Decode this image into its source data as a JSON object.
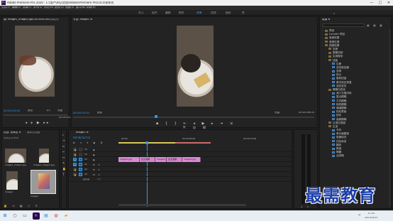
{
  "window": {
    "title": "Adobe Premiere Pro 2020 - C:\\用户\\dsy\\文档\\Adobe\\Premiere Pro\\14.0\\未命名",
    "min": "—",
    "max": "□",
    "close": "✕"
  },
  "menu": [
    "文件(F)",
    "编辑(E)",
    "剪辑(C)",
    "序列(S)",
    "标记(M)",
    "图形(G)",
    "视图(V)",
    "窗口(W)",
    "帮助(H)"
  ],
  "workspaces": [
    {
      "label": "学习",
      "active": false
    },
    {
      "label": "组件",
      "active": false
    },
    {
      "label": "编辑",
      "active": false
    },
    {
      "label": "颜色",
      "active": false
    },
    {
      "label": "效果",
      "active": true
    },
    {
      "label": "音频",
      "active": false
    },
    {
      "label": "图形",
      "active": false
    },
    {
      "label": "库",
      "active": false
    }
  ],
  "source": {
    "tab": "源: image1_image3.jpg 00:00:00:00",
    "tab2": "效果控件",
    "time_left": "00:00:00:00",
    "fit": "适合",
    "fraction": "1/2",
    "full": "完整",
    "time_right": "00:00:05:00"
  },
  "program": {
    "tab": "节目: image1 ≡",
    "time_left": "00:00:02:01",
    "fit": "适合",
    "full": "完整",
    "time_right": "00:00:06:00"
  },
  "project": {
    "tab": "项目: 未命名 ≡",
    "tab2": "媒体浏览器",
    "search_placeholder": "未命名.prproj",
    "items": [
      {
        "name": "image1_image1.jpg",
        "dur": "5:00"
      },
      {
        "name": "image1_image3.jpg",
        "dur": "5:00"
      },
      {
        "name": "image1",
        "dur": "5:00"
      },
      {
        "name": "image1",
        "dur": "6:00"
      }
    ]
  },
  "timeline": {
    "tab": "image1 ≡",
    "timecode": "00:00:02:01",
    "ruler": [
      "00:00",
      "00:00:05:00",
      "00:00:10:00"
    ],
    "tracks": [
      {
        "id": "V3"
      },
      {
        "id": "V2"
      },
      {
        "id": "V1"
      },
      {
        "id": "A1"
      },
      {
        "id": "A2"
      },
      {
        "id": "A3"
      },
      {
        "id": "主声道",
        "level": "0.0"
      }
    ],
    "clips": [
      "image1.jpg",
      "交叉溶解",
      "image2.jpg",
      "交叉溶解",
      "image3.jpg"
    ]
  },
  "effects": {
    "tab": "效果 ≡",
    "search": "",
    "items": [
      {
        "depth": 0,
        "type": "folder",
        "label": "预设"
      },
      {
        "depth": 0,
        "type": "folder",
        "label": "Lumetri 预设"
      },
      {
        "depth": 0,
        "type": "folder",
        "label": "音频效果"
      },
      {
        "depth": 0,
        "type": "folder",
        "label": "音频过渡"
      },
      {
        "depth": 0,
        "type": "folder",
        "label": "视频效果"
      },
      {
        "depth": 1,
        "type": "folder",
        "label": "变换"
      },
      {
        "depth": 1,
        "type": "folder",
        "label": "图像控制"
      },
      {
        "depth": 1,
        "type": "folder",
        "label": "实用程序"
      },
      {
        "depth": 1,
        "type": "folder",
        "label": "扭曲"
      },
      {
        "depth": 2,
        "type": "fx",
        "label": "位移"
      },
      {
        "depth": 2,
        "type": "fx",
        "label": "变形稳定器"
      },
      {
        "depth": 2,
        "type": "fx",
        "label": "变换"
      },
      {
        "depth": 2,
        "type": "fx",
        "label": "放大"
      },
      {
        "depth": 2,
        "type": "fx",
        "label": "旋转扭曲"
      },
      {
        "depth": 2,
        "type": "fx",
        "label": "果冻效应修复"
      },
      {
        "depth": 2,
        "type": "fx",
        "label": "波形变形"
      },
      {
        "depth": 1,
        "type": "folder",
        "label": "模糊与锐化"
      },
      {
        "depth": 2,
        "type": "fx",
        "label": "减少交错闪烁"
      },
      {
        "depth": 2,
        "type": "fx",
        "label": "复合模糊"
      },
      {
        "depth": 2,
        "type": "fx",
        "label": "方向模糊"
      },
      {
        "depth": 2,
        "type": "fx",
        "label": "相机模糊"
      },
      {
        "depth": 2,
        "type": "fx",
        "label": "通道模糊"
      },
      {
        "depth": 2,
        "type": "fx",
        "label": "钝化蒙版"
      },
      {
        "depth": 2,
        "type": "fx",
        "label": "锐化"
      },
      {
        "depth": 2,
        "type": "fx",
        "label": "高斯模糊"
      },
      {
        "depth": 1,
        "type": "folder",
        "label": "沉浸式视频"
      },
      {
        "depth": 1,
        "type": "folder",
        "label": "生成"
      },
      {
        "depth": 2,
        "type": "fx",
        "label": "书写"
      },
      {
        "depth": 2,
        "type": "fx",
        "label": "单元格图案"
      },
      {
        "depth": 2,
        "type": "fx",
        "label": "吸管填充"
      },
      {
        "depth": 2,
        "type": "fx",
        "label": "四色渐变"
      },
      {
        "depth": 2,
        "type": "fx",
        "label": "圆形"
      },
      {
        "depth": 2,
        "type": "fx",
        "label": "棋盘"
      },
      {
        "depth": 2,
        "type": "fx",
        "label": "椭圆"
      },
      {
        "depth": 2,
        "type": "fx",
        "label": "油漆桶"
      }
    ]
  },
  "taskbar": {
    "time": "17:20",
    "date": "2021/10/15",
    "lang": "中"
  },
  "watermark": "最需教育"
}
